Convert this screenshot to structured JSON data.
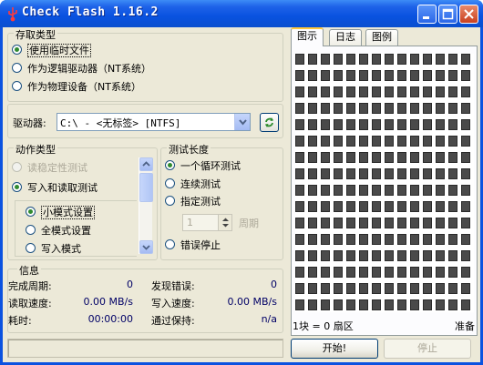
{
  "window": {
    "title": "Check Flash 1.16.2"
  },
  "access": {
    "group_label": "存取类型",
    "options": [
      {
        "label": "使用临时文件",
        "selected": true
      },
      {
        "label": "作为逻辑驱动器（NT系统）",
        "selected": false
      },
      {
        "label": "作为物理设备（NT系统）",
        "selected": false
      }
    ]
  },
  "drive": {
    "label": "驱动器:",
    "value": "C:\\ - <无标签> [NTFS]"
  },
  "action": {
    "group_label": "动作类型",
    "options": [
      {
        "label": "读稳定性测试",
        "selected": false,
        "disabled": true
      },
      {
        "label": "写入和读取测试",
        "selected": true,
        "disabled": false
      }
    ],
    "sub_options": [
      {
        "label": "小模式设置",
        "selected": true
      },
      {
        "label": "全模式设置",
        "selected": false
      },
      {
        "label": "写入模式",
        "selected": false
      }
    ]
  },
  "length": {
    "group_label": "测试长度",
    "options": [
      {
        "label": "一个循环测试",
        "selected": true
      },
      {
        "label": "连续测试",
        "selected": false
      },
      {
        "label": "指定测试",
        "selected": false
      }
    ],
    "spin_value": "1",
    "spin_unit": "周期",
    "stop_on_error": "错误停止"
  },
  "info": {
    "group_label": "信息",
    "rows": [
      {
        "label": "完成周期:",
        "value": "0",
        "label2": "发现错误:",
        "value2": "0"
      },
      {
        "label": "读取速度:",
        "value": "0.00 MB/s",
        "label2": "写入速度:",
        "value2": "0.00 MB/s"
      },
      {
        "label": "耗时:",
        "value": "00:00:00",
        "label2": "通过保持:",
        "value2": "n/a"
      }
    ]
  },
  "tabs": [
    "图示",
    "日志",
    "图例"
  ],
  "map": {
    "legend": "1块 = 0 扇区",
    "status": "准备",
    "cols": 14,
    "rows": 16
  },
  "buttons": {
    "start": "开始!",
    "stop": "停止"
  },
  "colors": {
    "title_blue": "#0b52e0",
    "block": "#4a4a4a",
    "accent_tab": "#ffc83c"
  }
}
